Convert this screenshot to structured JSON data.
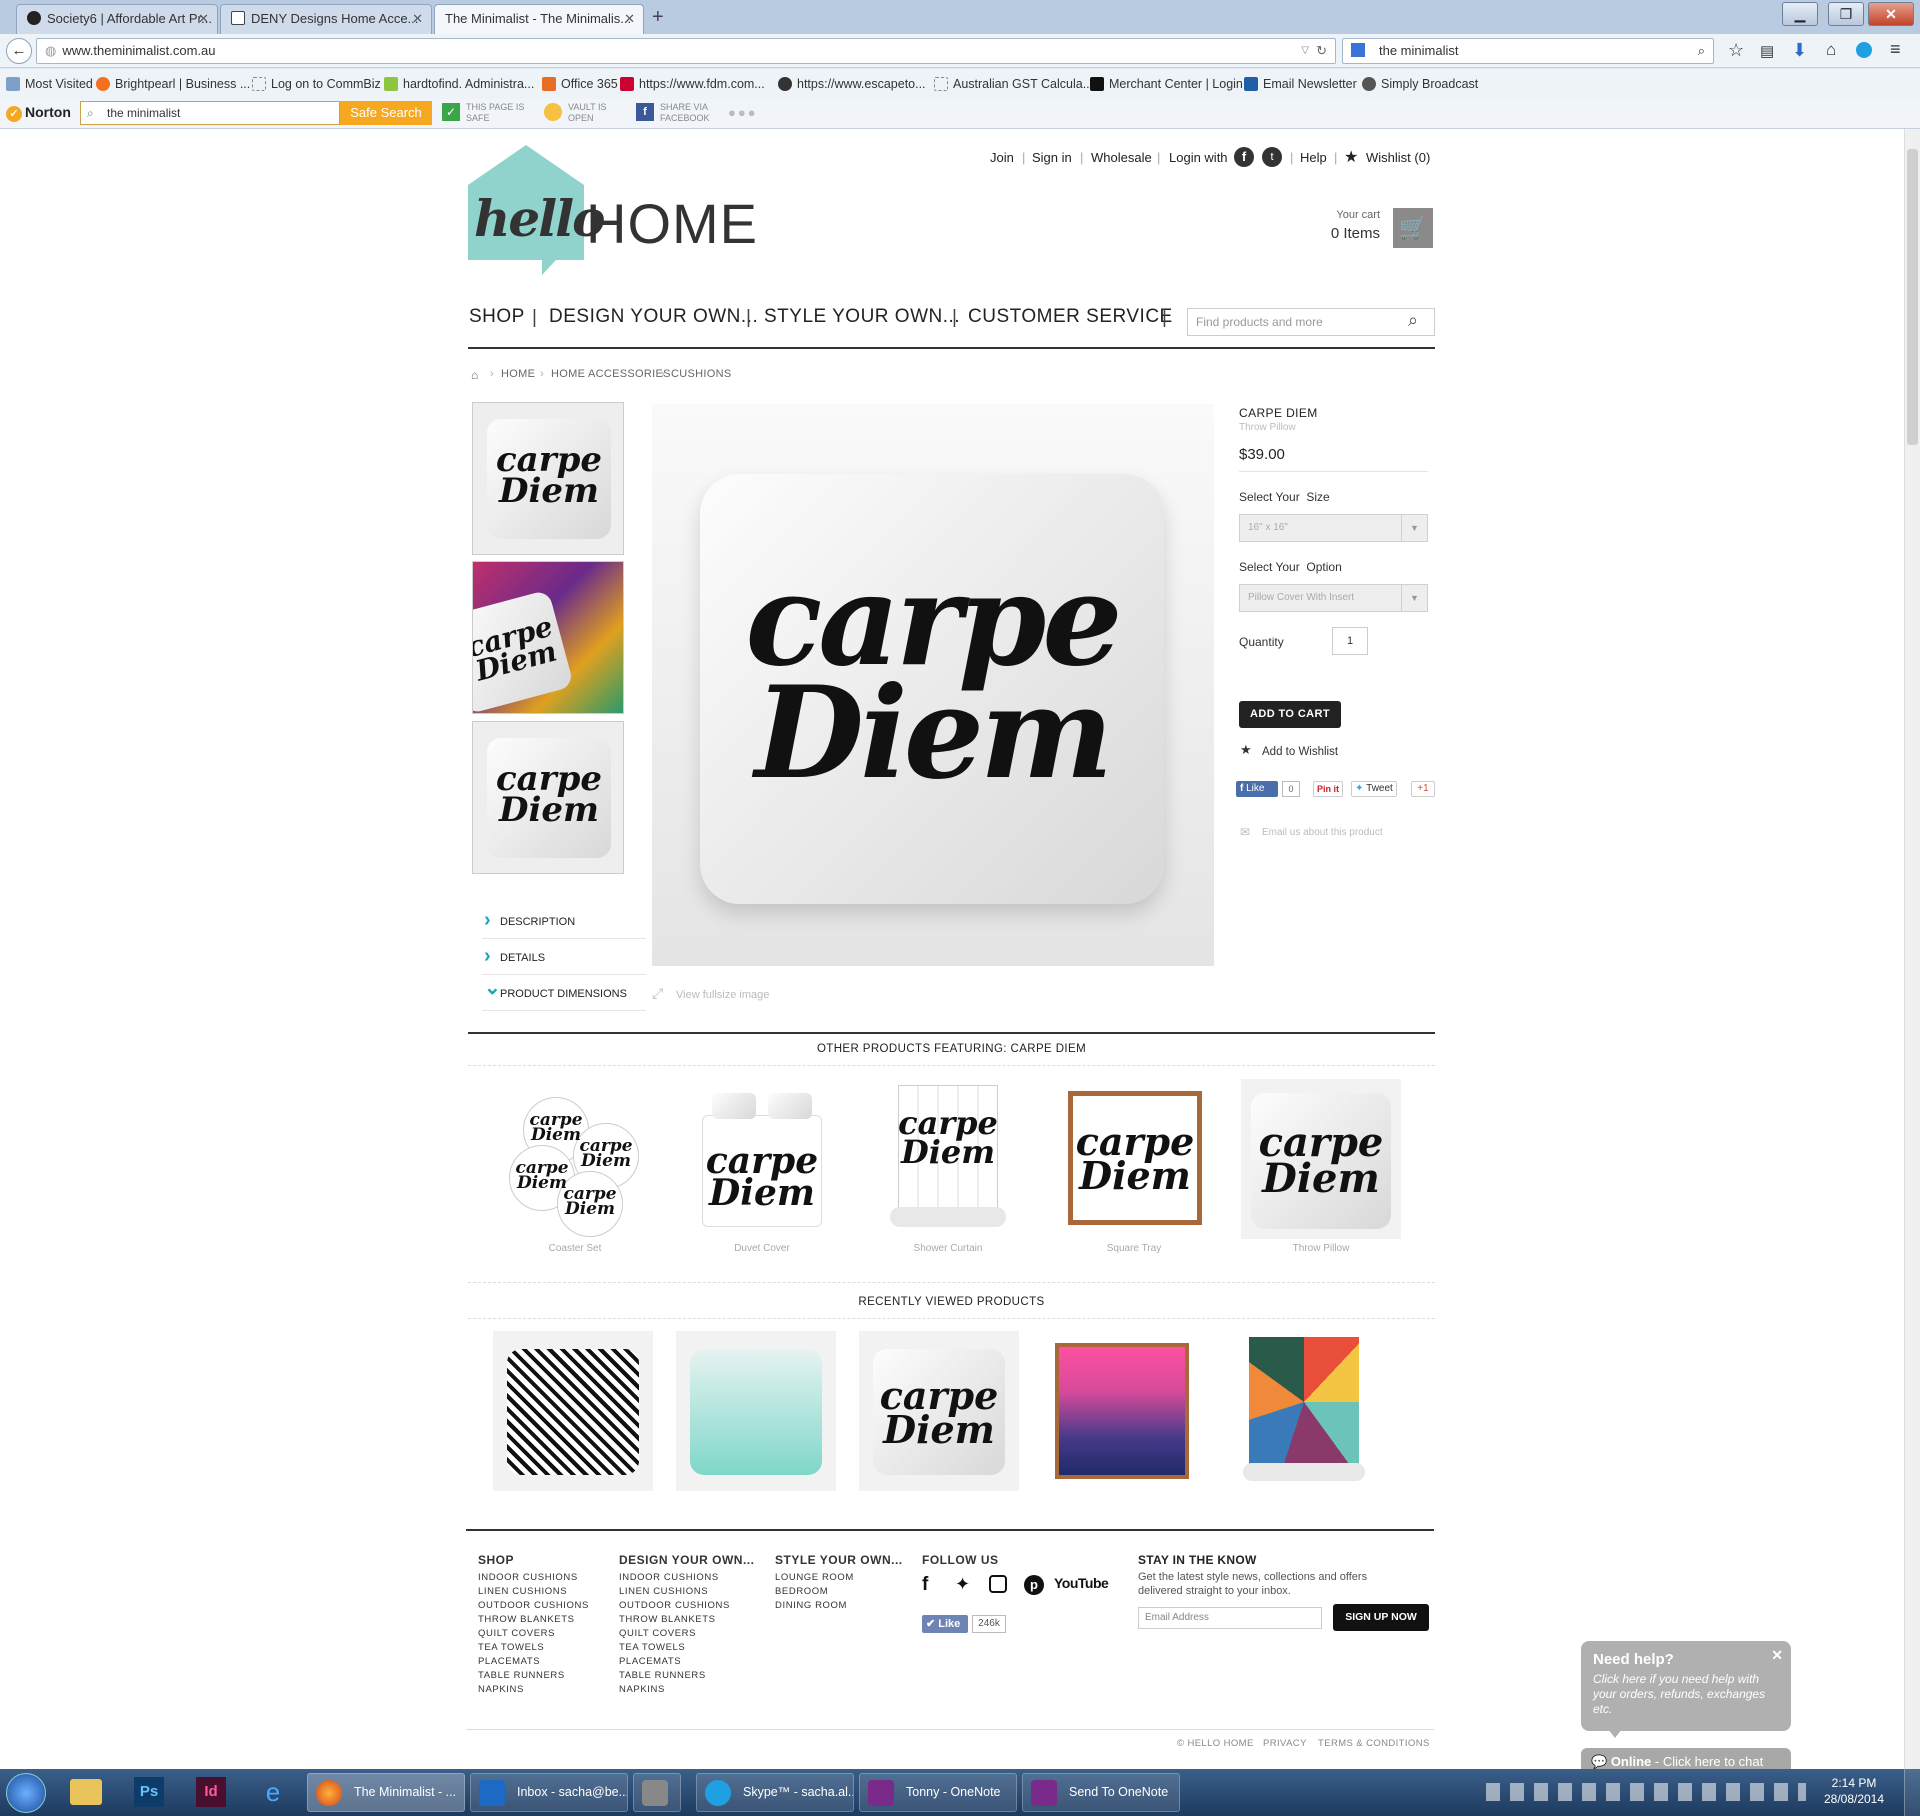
{
  "browser": {
    "tabs": [
      {
        "title": "Society6 | Affordable Art Pr...",
        "active": false
      },
      {
        "title": "DENY Designs Home Acce...",
        "active": false
      },
      {
        "title": "The Minimalist - The Minimalis...",
        "active": true
      }
    ],
    "url": "www.theminimalist.com.au",
    "search_value": "the minimalist",
    "bookmarks": [
      "Most Visited",
      "Brightpearl | Business ...",
      "Log on to CommBiz",
      "hardtofind. Administra...",
      "Office 365",
      "https://www.fdm.com...",
      "https://www.escapeto...",
      "Australian GST Calcula...",
      "Merchant Center | Login",
      "Email Newsletter",
      "Simply Broadcast"
    ],
    "norton": {
      "brand": "Norton",
      "search_value": "the minimalist",
      "search_button": "Safe Search",
      "safe_line1": "THIS PAGE IS",
      "safe_line2": "SAFE",
      "vault_line1": "VAULT IS",
      "vault_line2": "OPEN",
      "share_line1": "SHARE VIA",
      "share_line2": "FACEBOOK"
    }
  },
  "site": {
    "logo_hello": "hello",
    "logo_home": "HOME",
    "topnav": {
      "join": "Join",
      "signin": "Sign in",
      "wholesale": "Wholesale",
      "login_with": "Login with",
      "help": "Help",
      "wishlist": "Wishlist (0)"
    },
    "cart": {
      "label": "Your cart",
      "items": "0 Items"
    },
    "mainnav": [
      "SHOP",
      "DESIGN YOUR OWN...",
      "STYLE YOUR OWN...",
      "CUSTOMER SERVICE"
    ],
    "search_placeholder": "Find products and more",
    "breadcrumb": [
      "HOME",
      "HOME ACCESSORIES",
      "CUSHIONS"
    ],
    "artwork_line1": "carpe",
    "artwork_line2": "Diem"
  },
  "product": {
    "name": "CARPE DIEM",
    "type": "Throw Pillow",
    "price": "$39.00",
    "size_label": "Select Your  Size",
    "size_value": "16\" x 16\"",
    "option_label": "Select Your  Option",
    "option_value": "Pillow Cover With Insert",
    "quantity_label": "Quantity",
    "quantity_value": "1",
    "add_to_cart": "ADD TO CART",
    "add_to_wishlist": "Add to Wishlist",
    "social": {
      "like": "Like",
      "like_count": "0",
      "pin": "Pin it",
      "tweet": "Tweet",
      "gplus": "+1"
    },
    "email_link": "Email us about this product",
    "view_fullsize": "View fullsize image",
    "accordion": [
      "DESCRIPTION",
      "DETAILS",
      "PRODUCT DIMENSIONS"
    ]
  },
  "other_products": {
    "title": "OTHER PRODUCTS FEATURING: CARPE DIEM",
    "items": [
      "Coaster Set",
      "Duvet Cover",
      "Shower Curtain",
      "Square Tray",
      "Throw Pillow"
    ]
  },
  "recently_viewed": {
    "title": "RECENTLY VIEWED PRODUCTS"
  },
  "footer": {
    "shop": {
      "title": "SHOP",
      "links": [
        "INDOOR CUSHIONS",
        "LINEN CUSHIONS",
        "OUTDOOR CUSHIONS",
        "THROW BLANKETS",
        "QUILT COVERS",
        "TEA TOWELS",
        "PLACEMATS",
        "TABLE RUNNERS",
        "NAPKINS"
      ]
    },
    "design": {
      "title": "DESIGN YOUR OWN...",
      "links": [
        "INDOOR CUSHIONS",
        "LINEN CUSHIONS",
        "OUTDOOR CUSHIONS",
        "THROW BLANKETS",
        "QUILT COVERS",
        "TEA TOWELS",
        "PLACEMATS",
        "TABLE RUNNERS",
        "NAPKINS"
      ]
    },
    "style": {
      "title": "STYLE YOUR OWN...",
      "links": [
        "LOUNGE ROOM",
        "BEDROOM",
        "DINING ROOM"
      ]
    },
    "follow": {
      "title": "FOLLOW US",
      "like": "Like",
      "like_count": "246k",
      "youtube": "YouTube"
    },
    "newsletter": {
      "title": "STAY IN THE KNOW",
      "text1": "Get the latest style news, collections and offers",
      "text2": "delivered straight to your inbox.",
      "placeholder": "Email Address",
      "button": "SIGN UP NOW"
    },
    "copyright": "© HELLO HOME",
    "privacy": "PRIVACY",
    "terms": "TERMS & CONDITIONS"
  },
  "chat": {
    "title": "Need help?",
    "text": "Click here if you need help with your orders, refunds, exchanges etc.",
    "online_bold": "Online",
    "online_rest": " - Click here to chat"
  },
  "taskbar": {
    "items": [
      "The Minimalist - ...",
      "Inbox - sacha@be...",
      "Skype™ - sacha.al...",
      "Tonny - OneNote",
      "Send To OneNote"
    ],
    "time": "2:14 PM",
    "date": "28/08/2014"
  },
  "colors": {
    "accent_teal": "#8fd3cc",
    "brand_dark": "#333333",
    "norton_orange": "#f6a821",
    "button_dark": "#222222"
  }
}
